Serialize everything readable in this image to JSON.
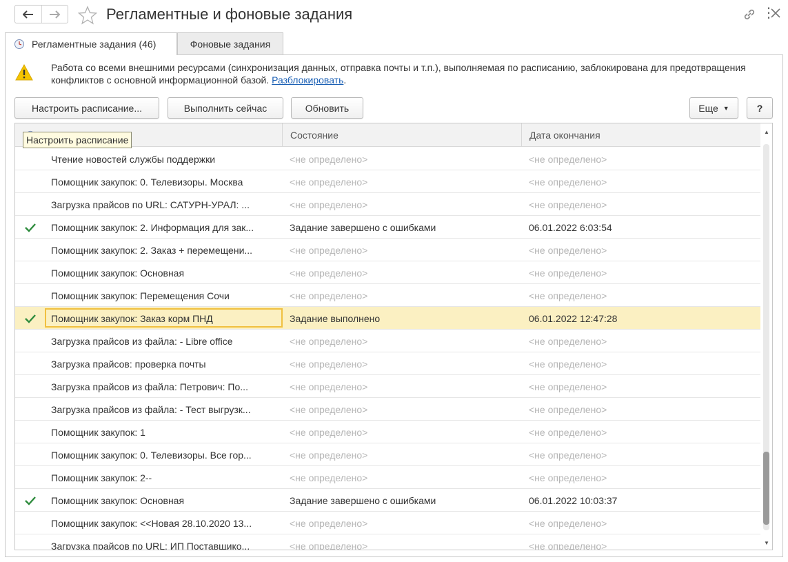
{
  "window": {
    "title": "Регламентные и фоновые задания"
  },
  "tabs": [
    {
      "label": "Регламентные задания (46)",
      "active": true
    },
    {
      "label": "Фоновые задания",
      "active": false
    }
  ],
  "warning": {
    "text": "Работа со всеми внешними ресурсами (синхронизация данных, отправка почты и т.п.), выполняемая по расписанию, заблокирована для предотвращения конфликтов с основной информационной базой.",
    "link": "Разблокировать",
    "suffix": "."
  },
  "toolbar": {
    "schedule_label": "Настроить расписание...",
    "run_now_label": "Выполнить сейчас",
    "refresh_label": "Обновить",
    "more_label": "Еще",
    "help_label": "?"
  },
  "tooltip": "Настроить расписание",
  "table": {
    "columns": {
      "state": "Состояние",
      "end_date": "Дата окончания"
    },
    "rows": [
      {
        "checked": false,
        "name": "Чтение новостей службы поддержки",
        "state": "<не определено>",
        "end_date": "<не определено>"
      },
      {
        "checked": false,
        "name": "Помощник закупок: 0. Телевизоры. Москва",
        "state": "<не определено>",
        "end_date": "<не определено>"
      },
      {
        "checked": false,
        "name": "Загрузка прайсов по URL: САТУРН-УРАЛ: ...",
        "state": "<не определено>",
        "end_date": "<не определено>"
      },
      {
        "checked": true,
        "name": "Помощник закупок: 2. Информация для зак...",
        "state": "Задание завершено с ошибками",
        "end_date": "06.01.2022 6:03:54"
      },
      {
        "checked": false,
        "name": "Помощник закупок: 2. Заказ + перемещени...",
        "state": "<не определено>",
        "end_date": "<не определено>"
      },
      {
        "checked": false,
        "name": "Помощник закупок: Основная",
        "state": "<не определено>",
        "end_date": "<не определено>"
      },
      {
        "checked": false,
        "name": "Помощник закупок: Перемещения Сочи",
        "state": "<не определено>",
        "end_date": "<не определено>"
      },
      {
        "checked": true,
        "selected": true,
        "name": "Помощник закупок: Заказ корм ПНД",
        "state": "Задание выполнено",
        "end_date": "06.01.2022 12:47:28"
      },
      {
        "checked": false,
        "name": "Загрузка прайсов из файла: - Libre office",
        "state": "<не определено>",
        "end_date": "<не определено>"
      },
      {
        "checked": false,
        "name": "Загрузка прайсов: проверка почты",
        "state": "<не определено>",
        "end_date": "<не определено>"
      },
      {
        "checked": false,
        "name": "Загрузка прайсов из файла: Петрович: По...",
        "state": "<не определено>",
        "end_date": "<не определено>"
      },
      {
        "checked": false,
        "name": "Загрузка прайсов из файла: - Тест выгрузк...",
        "state": "<не определено>",
        "end_date": "<не определено>"
      },
      {
        "checked": false,
        "name": "Помощник закупок: 1",
        "state": "<не определено>",
        "end_date": "<не определено>"
      },
      {
        "checked": false,
        "name": "Помощник закупок: 0. Телевизоры. Все гор...",
        "state": "<не определено>",
        "end_date": "<не определено>"
      },
      {
        "checked": false,
        "name": "Помощник закупок: 2--",
        "state": "<не определено>",
        "end_date": "<не определено>"
      },
      {
        "checked": true,
        "name": "Помощник закупок: Основная",
        "state": "Задание завершено с ошибками",
        "end_date": "06.01.2022 10:03:37"
      },
      {
        "checked": false,
        "name": "Помощник закупок: <<Новая 28.10.2020 13...",
        "state": "<не определено>",
        "end_date": "<не определено>"
      },
      {
        "checked": false,
        "name": "Загрузка прайсов по URL: ИП Поставщико...",
        "state": "<не определено>",
        "end_date": "<не определено>"
      }
    ]
  },
  "colors": {
    "selected_row": "#fbf0c2",
    "check": "#2e8b3d",
    "link": "#1a5fb4",
    "warning": "#f5c400"
  }
}
